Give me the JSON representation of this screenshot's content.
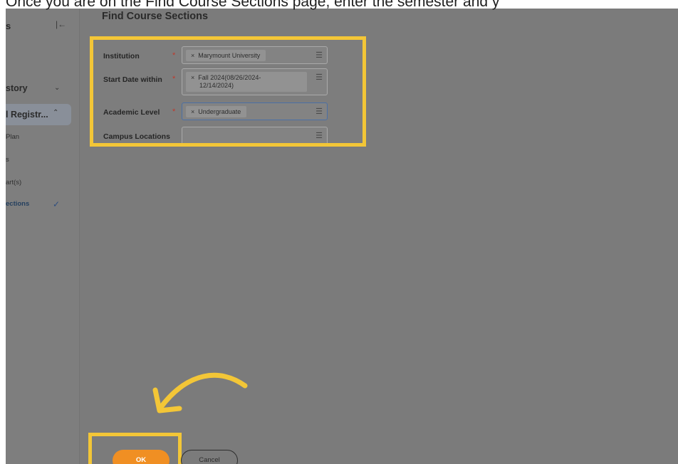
{
  "instruction": "Once you are on the Find Course Sections page, enter the semester and y",
  "sidebar": {
    "title": "s",
    "collapse_icon": "collapse-icon",
    "items": [
      {
        "label": "story",
        "expand": "chevron-down"
      },
      {
        "label": "l Registr...",
        "expand": "chevron-up"
      },
      {
        "label": "Plan"
      },
      {
        "label": "s"
      },
      {
        "label": "art(s)"
      },
      {
        "label": "ections",
        "check": "checkmark"
      }
    ]
  },
  "page_title": "Find Course Sections",
  "form": {
    "institution": {
      "label": "Institution",
      "value": "Marymount University"
    },
    "start_date": {
      "label": "Start Date within",
      "value_line1": "Fall 2024(08/26/2024-",
      "value_line2": "12/14/2024)"
    },
    "academic_level": {
      "label": "Academic Level",
      "value": "Undergraduate"
    },
    "campus_locations": {
      "label": "Campus Locations",
      "value": ""
    },
    "required_mark": "*",
    "chip_remove": "×",
    "list_icon": "list-icon"
  },
  "buttons": {
    "ok": "OK",
    "cancel": "Cancel"
  },
  "colors": {
    "highlight": "#f3c637",
    "ok_button": "#f08f23",
    "overlay": "#7b7b7b"
  }
}
